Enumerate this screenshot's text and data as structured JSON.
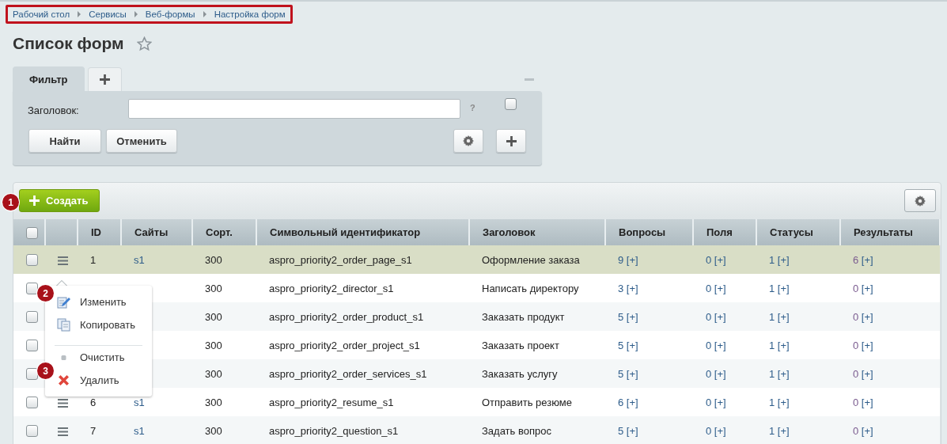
{
  "breadcrumbs": [
    {
      "label": "Рабочий стол"
    },
    {
      "label": "Сервисы"
    },
    {
      "label": "Веб-формы"
    },
    {
      "label": "Настройка форм"
    }
  ],
  "title": "Список форм",
  "filter": {
    "tabs": [
      {
        "kind": "text",
        "label": "Фильтр",
        "selected": true
      },
      {
        "kind": "add",
        "selected": false
      }
    ],
    "field_label": "Заголовок:",
    "help": "?",
    "checked": false,
    "buttons": [
      "Найти",
      "Отменить"
    ]
  },
  "create_button": "Создать",
  "table": {
    "select_all_checked": false,
    "columns": [
      "ID",
      "Сайты",
      "Сорт.",
      "Символьный идентификатор",
      "Заголовок",
      "Вопросы",
      "Поля",
      "Статусы",
      "Результаты"
    ],
    "rows": [
      {
        "selected": true,
        "checked": false,
        "id": "1",
        "site": "s1",
        "sort": "300",
        "code": "aspro_priority2_order_page_s1",
        "title": "Оформление заказа",
        "counts": [
          {
            "value": "9",
            "link": "[+]"
          },
          {
            "value": "0",
            "link": "[+]"
          },
          {
            "value": "1",
            "link": "[+]"
          },
          {
            "value": "6",
            "link": "[+]"
          }
        ]
      },
      {
        "selected": false,
        "checked": false,
        "sort": "300",
        "code": "aspro_priority2_director_s1",
        "title": "Написать директору",
        "counts": [
          {
            "value": "3",
            "link": "[+]"
          },
          {
            "value": "0",
            "link": "[+]"
          },
          {
            "value": "1",
            "link": "[+]"
          },
          {
            "value": "0",
            "link": "[+]"
          }
        ]
      },
      {
        "selected": false,
        "checked": false,
        "sort": "300",
        "code": "aspro_priority2_order_product_s1",
        "title": "Заказать продукт",
        "counts": [
          {
            "value": "5",
            "link": "[+]"
          },
          {
            "value": "0",
            "link": "[+]"
          },
          {
            "value": "1",
            "link": "[+]"
          },
          {
            "value": "0",
            "link": "[+]"
          }
        ]
      },
      {
        "selected": false,
        "checked": false,
        "sort": "300",
        "code": "aspro_priority2_order_project_s1",
        "title": "Заказать проект",
        "counts": [
          {
            "value": "5",
            "link": "[+]"
          },
          {
            "value": "0",
            "link": "[+]"
          },
          {
            "value": "1",
            "link": "[+]"
          },
          {
            "value": "0",
            "link": "[+]"
          }
        ]
      },
      {
        "selected": false,
        "checked": false,
        "sort": "300",
        "code": "aspro_priority2_order_services_s1",
        "title": "Заказать услугу",
        "counts": [
          {
            "value": "5",
            "link": "[+]"
          },
          {
            "value": "0",
            "link": "[+]"
          },
          {
            "value": "1",
            "link": "[+]"
          },
          {
            "value": "0",
            "link": "[+]"
          }
        ]
      },
      {
        "selected": false,
        "checked": false,
        "id": "6",
        "site": "s1",
        "sort": "300",
        "code": "aspro_priority2_resume_s1",
        "title": "Отправить резюме",
        "counts": [
          {
            "value": "6",
            "link": "[+]"
          },
          {
            "value": "0",
            "link": "[+]"
          },
          {
            "value": "1",
            "link": "[+]"
          },
          {
            "value": "0",
            "link": "[+]"
          }
        ]
      },
      {
        "selected": false,
        "checked": false,
        "id": "7",
        "site": "s1",
        "sort": "300",
        "code": "aspro_priority2_question_s1",
        "title": "Задать вопрос",
        "counts": [
          {
            "value": "5",
            "link": "[+]"
          },
          {
            "value": "0",
            "link": "[+]"
          },
          {
            "value": "1",
            "link": "[+]"
          },
          {
            "value": "0",
            "link": "[+]"
          }
        ]
      }
    ]
  },
  "context_menu": {
    "items": [
      {
        "kind": "edit",
        "label": "Изменить"
      },
      {
        "kind": "copy",
        "label": "Копировать"
      },
      {
        "kind": "separator"
      },
      {
        "kind": "clear",
        "label": "Очистить"
      },
      {
        "kind": "delete",
        "label": "Удалить"
      }
    ]
  },
  "callouts": [
    "1",
    "2",
    "3"
  ]
}
